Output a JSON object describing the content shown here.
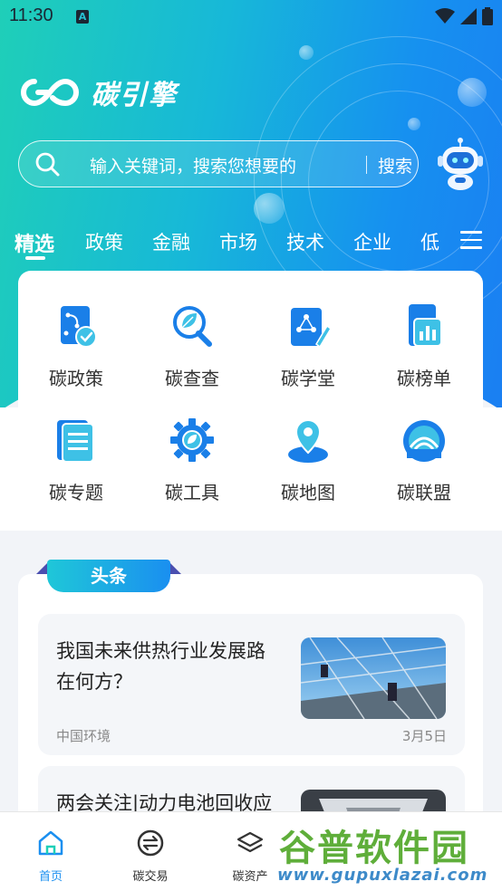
{
  "status_bar": {
    "time": "11:30",
    "notification_badge": "A"
  },
  "brand": {
    "name": "碳引擎"
  },
  "search": {
    "placeholder": "输入关键词，搜索您想要的",
    "button_label": "搜索"
  },
  "tabs": [
    {
      "label": "精选",
      "active": true
    },
    {
      "label": "政策"
    },
    {
      "label": "金融"
    },
    {
      "label": "市场"
    },
    {
      "label": "技术"
    },
    {
      "label": "企业"
    },
    {
      "label": "低"
    }
  ],
  "quick_links": [
    {
      "label": "碳政策",
      "icon": "policy-icon"
    },
    {
      "label": "碳查查",
      "icon": "search-leaf-icon"
    },
    {
      "label": "碳学堂",
      "icon": "classroom-icon"
    },
    {
      "label": "碳榜单",
      "icon": "ranking-icon"
    },
    {
      "label": "碳专题",
      "icon": "topic-icon"
    },
    {
      "label": "碳工具",
      "icon": "tool-gear-icon"
    },
    {
      "label": "碳地图",
      "icon": "map-pin-icon"
    },
    {
      "label": "碳联盟",
      "icon": "alliance-icon"
    }
  ],
  "headlines": {
    "tag_label": "头条",
    "items": [
      {
        "title": "我国未来供热行业发展路在何方？",
        "source": "中国环境",
        "date": "3月5日"
      },
      {
        "title": "两会关注|动力电池回收应避免“优币驱逐良币”",
        "source": "",
        "date": ""
      }
    ]
  },
  "bottom_nav": [
    {
      "label": "首页",
      "icon": "home-icon",
      "active": true
    },
    {
      "label": "碳交易",
      "icon": "exchange-icon"
    },
    {
      "label": "碳资产",
      "icon": "layers-icon"
    },
    {
      "label": "",
      "icon": ""
    },
    {
      "label": "",
      "icon": ""
    }
  ],
  "watermark": {
    "title": "谷普软件园",
    "url": "www.gupuxlazai.com"
  },
  "colors": {
    "accent": "#1a8ff0",
    "accent_teal": "#1fcfb8",
    "text": "#333333"
  }
}
